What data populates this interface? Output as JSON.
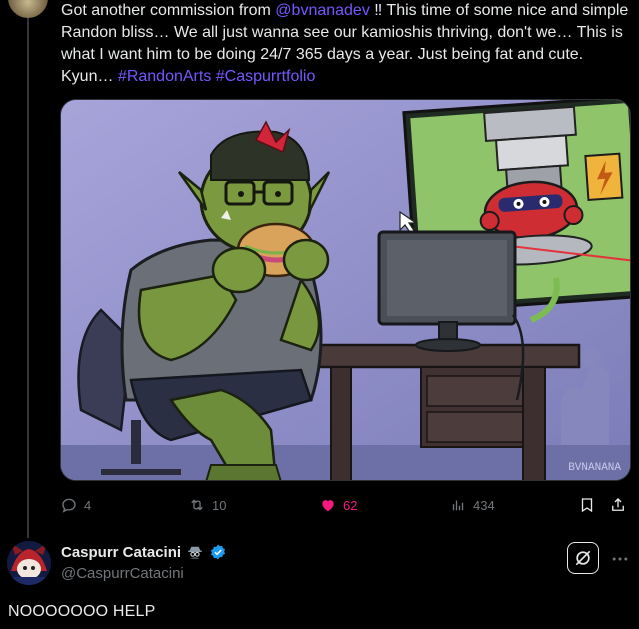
{
  "tweet": {
    "text_part1": "Got another commission from ",
    "mention": "@bvnanadev",
    "text_part2": " ‼ This time of some nice and simple Randon bliss… We all just wanna see our kamioshis thriving, don't we… This is what I want him to be doing 24/7 365 days a year. Just being fat and cute. Kyun… ",
    "hashtag1": "#RandonArts",
    "hashtag2": "#Caspurrtfolio",
    "media": {
      "signature": "BVNANANA"
    },
    "actions": {
      "replies": "4",
      "reposts": "10",
      "likes": "62",
      "views": "434"
    }
  },
  "reply": {
    "display_name": "Caspurr Catacini",
    "handle": "@CaspurrCatacini",
    "text": "NOOOOOOO HELP"
  },
  "colors": {
    "accent": "#7856ff",
    "like": "#f91880",
    "muted": "#71767b",
    "verified": "#1d9bf0"
  },
  "icons": [
    "reply-icon",
    "repost-icon",
    "heart-icon",
    "views-icon",
    "bookmark-icon",
    "share-icon",
    "verified-icon",
    "spy-icon",
    "grok-icon",
    "more-icon"
  ]
}
